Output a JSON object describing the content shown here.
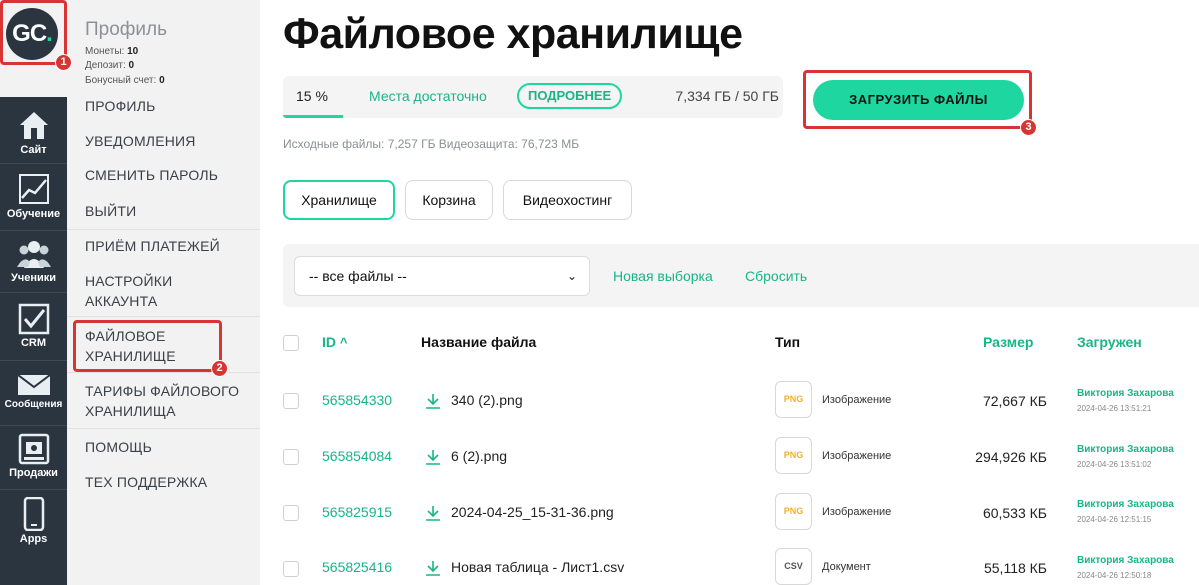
{
  "app": {
    "logo_text": "GC",
    "logo_dot": ".",
    "brand_color": "#1ed6a0",
    "rail_color": "#2b3540"
  },
  "rail": [
    {
      "label": "Сайт",
      "icon": "house-icon"
    },
    {
      "label": "Обучение",
      "icon": "chart-icon"
    },
    {
      "label": "Ученики",
      "icon": "users-icon"
    },
    {
      "label": "CRM",
      "icon": "checkbox-icon"
    },
    {
      "label": "Сообщения",
      "icon": "envelope-icon"
    },
    {
      "label": "Продажи",
      "icon": "register-icon"
    },
    {
      "label": "Apps",
      "icon": "phone-icon"
    }
  ],
  "profile_menu": {
    "title": "Профиль",
    "stats": [
      {
        "label": "Монеты:",
        "value": "10"
      },
      {
        "label": "Депозит:",
        "value": "0"
      },
      {
        "label": "Бонусный счет:",
        "value": "0"
      }
    ],
    "items": [
      "ПРОФИЛЬ",
      "УВЕДОМЛЕНИЯ",
      "СМЕНИТЬ ПАРОЛЬ",
      "ВЫЙТИ",
      "ПРИЁМ ПЛАТЕЖЕЙ",
      "НАСТРОЙКИ АККАУНТА",
      "ФАЙЛОВОЕ ХРАНИЛИЩЕ",
      "ТАРИФЫ ФАЙЛОВОГО ХРАНИЛИЩА",
      "ПОМОЩЬ",
      "ТЕХ ПОДДЕРЖКА"
    ]
  },
  "page": {
    "title": "Файловое хранилище",
    "storage": {
      "percent_label": "15 %",
      "percent_value": 15,
      "status": "Места достаточно",
      "details_button": "ПОДРОБНЕЕ",
      "used": "7,334 ГБ / 50 ГБ"
    },
    "upload_button": "ЗАГРУЗИТЬ ФАЙЛЫ",
    "sub_info": "Исходные файлы: 7,257 ГБ Видеозащита: 76,723 МБ",
    "tabs": [
      "Хранилище",
      "Корзина",
      "Видеохостинг"
    ],
    "active_tab": "Хранилище",
    "filter": {
      "select_value": "-- все файлы --",
      "new_selection": "Новая выборка",
      "reset": "Сбросить"
    },
    "table": {
      "columns": [
        "ID",
        "Название файла",
        "Тип",
        "Размер",
        "Загружен"
      ],
      "sort_indicator": "^",
      "rows": [
        {
          "id": "565854330",
          "name": "340 (2).png",
          "type_badge": "PNG",
          "type": "Изображение",
          "size": "72,667 КБ",
          "uploader": "Виктория Захарова",
          "date": "2024-04-26 13:51:21"
        },
        {
          "id": "565854084",
          "name": "6 (2).png",
          "type_badge": "PNG",
          "type": "Изображение",
          "size": "294,926 КБ",
          "uploader": "Виктория Захарова",
          "date": "2024-04-26 13:51:02"
        },
        {
          "id": "565825915",
          "name": "2024-04-25_15-31-36.png",
          "type_badge": "PNG",
          "type": "Изображение",
          "size": "60,533 КБ",
          "uploader": "Виктория Захарова",
          "date": "2024-04-26 12:51:15"
        },
        {
          "id": "565825416",
          "name": "Новая таблица - Лист1.csv",
          "type_badge": "CSV",
          "type": "Документ",
          "size": "55,118 КБ",
          "uploader": "Виктория Захарова",
          "date": "2024-04-26 12:50:18"
        }
      ]
    }
  },
  "annotations": [
    "1",
    "2",
    "3"
  ],
  "colors": {
    "accent": "#1ed6a0",
    "accent_text": "#18b585",
    "annotation": "#d93434",
    "png_badge": "#f0b030",
    "csv_badge": "#555555"
  }
}
